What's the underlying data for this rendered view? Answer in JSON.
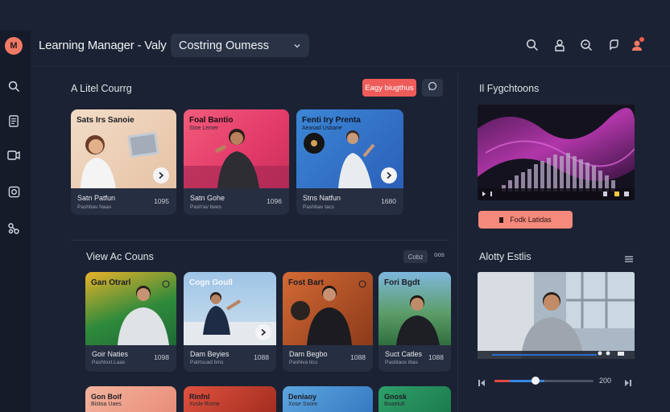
{
  "app": {
    "title": "Learning Manager - Valy",
    "course_select": "Costring Oumess"
  },
  "colors": {
    "accent": "#ee5c5a",
    "coral": "#f58a7c",
    "background": "#1b2233",
    "sidebar": "#151b29",
    "card": "#262e41"
  },
  "logo": {
    "text": "M"
  },
  "sidebar": {
    "icons": [
      "search-icon",
      "document-icon",
      "video-icon",
      "gallery-icon",
      "settings-icon"
    ]
  },
  "topbar": {
    "icons": [
      "search-icon",
      "user-icon",
      "zoom-icon",
      "bookmark-icon",
      "profile-icon"
    ]
  },
  "latest": {
    "title": "A Litel Courrg",
    "primary_button": "Eagy biugthus",
    "cards": [
      {
        "thumb_title": "Sats Irs Sanoie",
        "title": "Satn Patfun",
        "sub": "Pashbav Naas",
        "count": "1095"
      },
      {
        "thumb_title": "Foal Bantio",
        "thumb_sub": "Stoe Lemer",
        "title": "Satn Gohe",
        "sub": "Pash'av bees",
        "count": "1096"
      },
      {
        "thumb_title": "Fenti Iry Prenta",
        "thumb_sub": "Aeasad Usbane",
        "title": "Stns Natfun",
        "sub": "Pashbav tacs",
        "count": "1680"
      }
    ]
  },
  "view_all": {
    "title": "View Ac Couns",
    "toggle": "Cobz",
    "more": "oos",
    "cards": [
      {
        "thumb_title": "Gan Otrarl",
        "title": "Goir Naties",
        "sub": "Pashtoxt.Laas",
        "count": "1098"
      },
      {
        "thumb_title": "Cogn Goull",
        "title": "Dam Beyies",
        "sub": "Patrtsuad tims",
        "count": "1088"
      },
      {
        "thumb_title": "Fost Bart",
        "title": "Dam Begbo",
        "sub": "Pashiva ticu",
        "count": "1088"
      },
      {
        "thumb_title": "Fori Bgdt",
        "title": "Suct Catles",
        "sub": "Pasbtaos ibas",
        "count": "1088"
      }
    ],
    "bottom_cards": [
      {
        "thumb_title": "Gon Boif",
        "thumb_sub": "Bistoa Uaes"
      },
      {
        "thumb_title": "Rinfnl",
        "thumb_sub": "Xvsle Rome"
      },
      {
        "thumb_title": "Deniaoy",
        "thumb_sub": "Xose Ssore"
      },
      {
        "thumb_title": "Gnosk",
        "thumb_sub": "Boaelutl"
      }
    ]
  },
  "right": {
    "playlist_title": "Il Fygchtoons",
    "player_button": "Fodk Latidas",
    "activity_title": "Alotty Estlis",
    "progress": 0.5,
    "time": "200"
  }
}
